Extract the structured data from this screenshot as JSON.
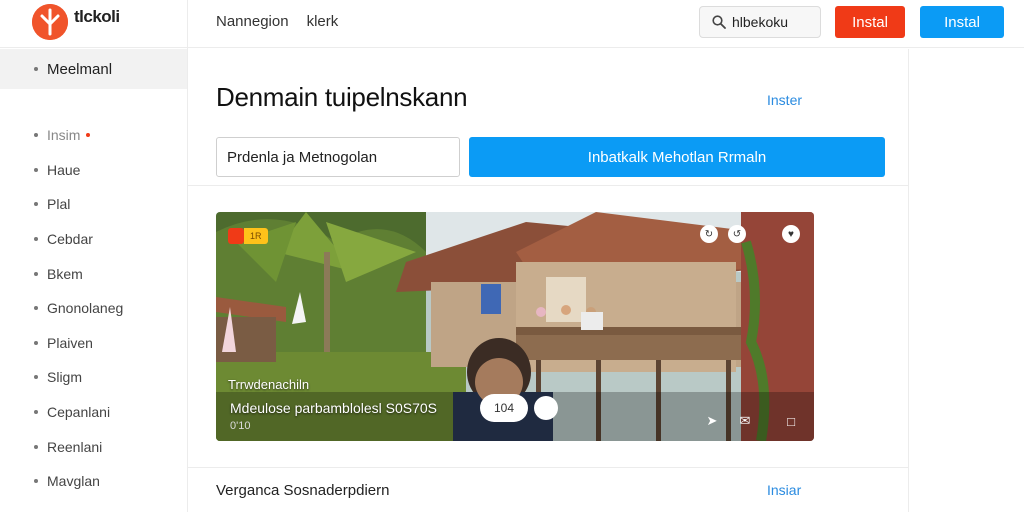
{
  "header": {
    "brand": "tlckoli",
    "nav": [
      "Nannegion",
      "klerk"
    ],
    "search": {
      "value": "hlbekoku"
    },
    "btn_red": "Instal",
    "btn_blue": "Instal"
  },
  "sidebar": {
    "active": "Meelmanl",
    "items": [
      {
        "label": "Insim"
      },
      {
        "label": "Haue"
      },
      {
        "label": "Plal"
      },
      {
        "label": "Cebdar"
      },
      {
        "label": "Bkem"
      },
      {
        "label": "Gnonolaneg"
      },
      {
        "label": "Plaiven"
      },
      {
        "label": "Sligm"
      },
      {
        "label": "Cepanlani"
      },
      {
        "label": "Reenlani"
      },
      {
        "label": "Mavglan"
      }
    ]
  },
  "main": {
    "title": "Denmain tuipelnskann",
    "link_top": "Inster",
    "field_value": "Prdenla ja Metnogolan",
    "wide_button": "Inbatkalk Mehotlan Rrmaln",
    "media": {
      "badge": "1R",
      "caption": "Trrwdenachiln",
      "subtitle": "Mdeulose parbamblolesl S0S70S",
      "time": "0'10",
      "pill": "104"
    },
    "bottom_title": "Verganca Sosnaderpdiern",
    "link_bottom": "Insiar"
  },
  "colors": {
    "accent_red": "#f03a17",
    "accent_blue": "#0b9bf5",
    "link_blue": "#2a8be0"
  }
}
